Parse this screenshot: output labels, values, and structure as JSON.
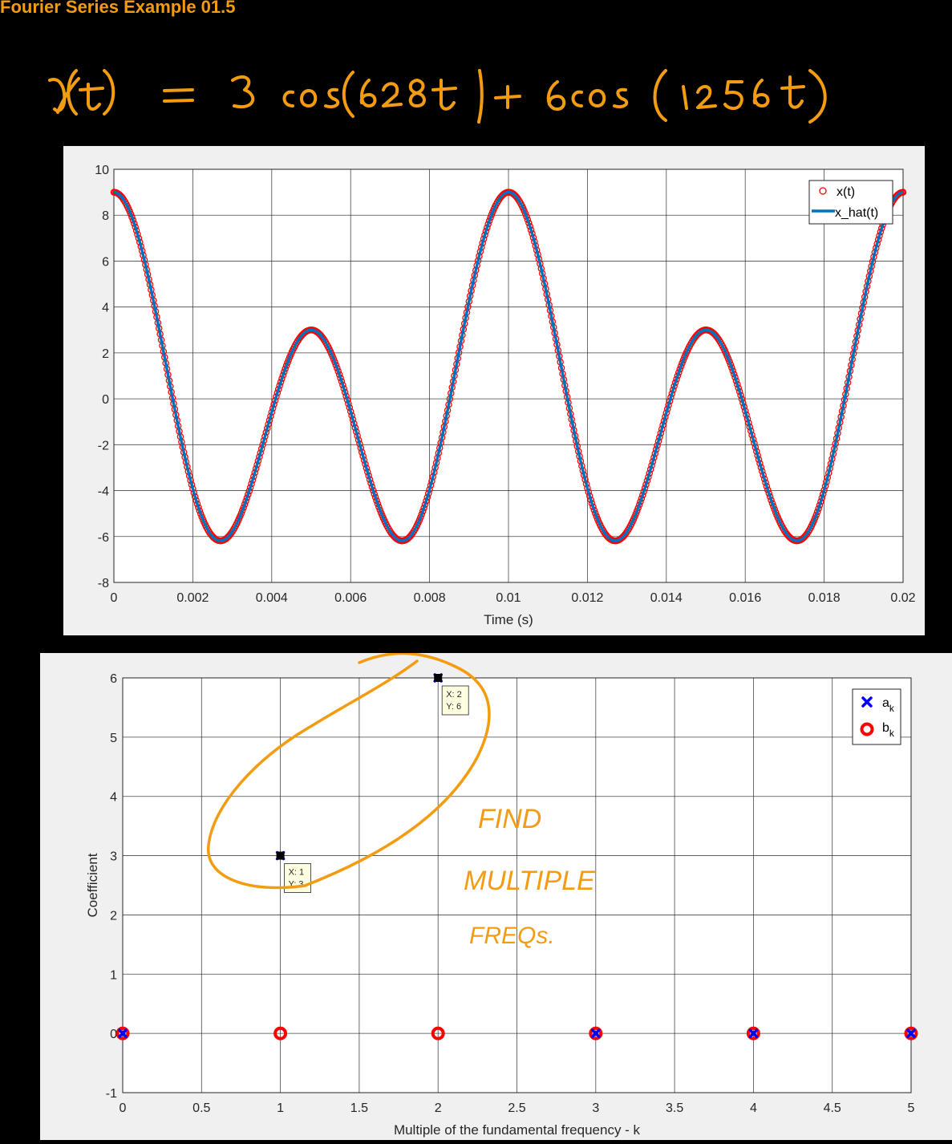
{
  "page": {
    "title": "Fourier Series Example 01.5",
    "equation": "x(t) = 3 cos(628t) + 6cos(1256t)"
  },
  "chart_data": [
    {
      "type": "line",
      "xlabel": "Time (s)",
      "ylabel": "",
      "xlim": [
        0,
        0.02
      ],
      "ylim": [
        -8,
        10
      ],
      "xticks": [
        0,
        0.002,
        0.004,
        0.006,
        0.008,
        0.01,
        0.012,
        0.014,
        0.016,
        0.018,
        0.02
      ],
      "xtick_labels": [
        "0",
        "0.002",
        "0.004",
        "0.006",
        "0.008",
        "0.01",
        "0.012",
        "0.014",
        "0.016",
        "0.018",
        "0.02"
      ],
      "yticks": [
        -8,
        -6,
        -4,
        -2,
        0,
        2,
        4,
        6,
        8,
        10
      ],
      "ytick_labels": [
        "-8",
        "-6",
        "-4",
        "-2",
        "0",
        "2",
        "4",
        "6",
        "8",
        "10"
      ],
      "grid": true,
      "legend_position": "top-right",
      "series": [
        {
          "name": "x(t)",
          "style": "circle-markers",
          "color": "#ff0000",
          "expression": "3cos(628t)+6cos(1256t)",
          "components": [
            {
              "amp": 3,
              "freq": 628
            },
            {
              "amp": 6,
              "freq": 1256
            }
          ]
        },
        {
          "name": "x_hat(t)",
          "style": "line",
          "color": "#0072bd",
          "expression": "3cos(628t)+6cos(1256t)",
          "components": [
            {
              "amp": 3,
              "freq": 628
            },
            {
              "amp": 6,
              "freq": 1256
            }
          ]
        }
      ]
    },
    {
      "type": "scatter",
      "xlabel": "Multiple of the fundamental frequency - k",
      "ylabel": "Coefficient",
      "xlim": [
        0,
        5
      ],
      "ylim": [
        -1,
        6
      ],
      "xticks": [
        0,
        0.5,
        1,
        1.5,
        2,
        2.5,
        3,
        3.5,
        4,
        4.5,
        5
      ],
      "xtick_labels": [
        "0",
        "0.5",
        "1",
        "1.5",
        "2",
        "2.5",
        "3",
        "3.5",
        "4",
        "4.5",
        "5"
      ],
      "yticks": [
        -1,
        0,
        1,
        2,
        3,
        4,
        5,
        6
      ],
      "ytick_labels": [
        "-1",
        "0",
        "1",
        "2",
        "3",
        "4",
        "5",
        "6"
      ],
      "grid": true,
      "legend_position": "top-right",
      "series": [
        {
          "name": "a",
          "subscript": "k",
          "marker": "x",
          "color": "#0000ff",
          "x": [
            0,
            1,
            2,
            3,
            4,
            5
          ],
          "y": [
            0,
            3,
            6,
            0,
            0,
            0
          ]
        },
        {
          "name": "b",
          "subscript": "k",
          "marker": "o",
          "color": "#ff0000",
          "x": [
            0,
            1,
            2,
            3,
            4,
            5
          ],
          "y": [
            0,
            0,
            0,
            0,
            0,
            0
          ]
        }
      ],
      "datatips": [
        {
          "x_label": "X: 1",
          "y_label": "Y: 3",
          "x": 1,
          "y": 3
        },
        {
          "x_label": "X: 2",
          "y_label": "Y: 6",
          "x": 2,
          "y": 6
        }
      ],
      "annotations": [
        "FIND",
        "MULTIPLE",
        "FREQs."
      ]
    }
  ],
  "colors": {
    "annotation": "#f39c12",
    "background": "#000000",
    "figure": "#f0f0f0"
  }
}
